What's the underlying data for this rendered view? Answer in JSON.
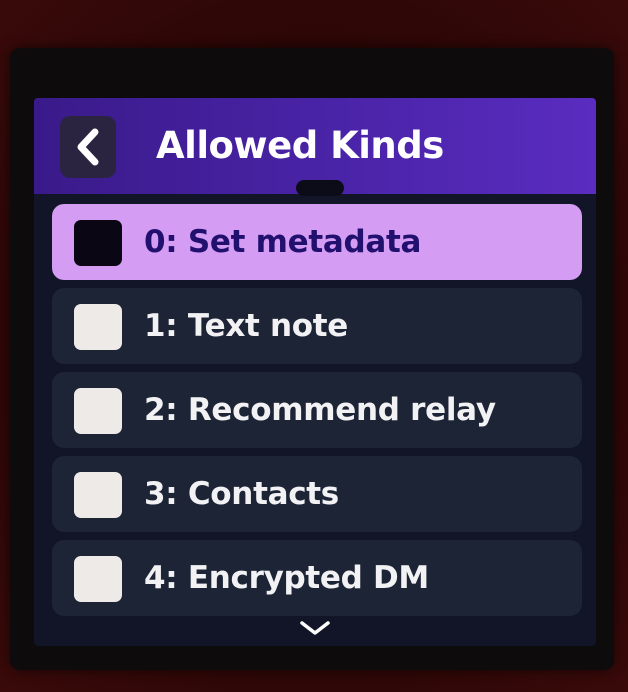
{
  "header": {
    "title": "Allowed Kinds",
    "back_icon": "chevron-left-icon"
  },
  "kinds": [
    {
      "label": "0: Set metadata",
      "checked": false,
      "focused": true
    },
    {
      "label": "1: Text note",
      "checked": false,
      "focused": false
    },
    {
      "label": "2: Recommend relay",
      "checked": false,
      "focused": false
    },
    {
      "label": "3: Contacts",
      "checked": false,
      "focused": false
    },
    {
      "label": "4: Encrypted DM",
      "checked": false,
      "focused": false
    }
  ],
  "more_indicator": "chevron-down-icon",
  "colors": {
    "header_bg": "#4a24a8",
    "selected_bg": "#d49cf2",
    "item_bg": "#1c2436",
    "screen_bg": "#121428"
  }
}
